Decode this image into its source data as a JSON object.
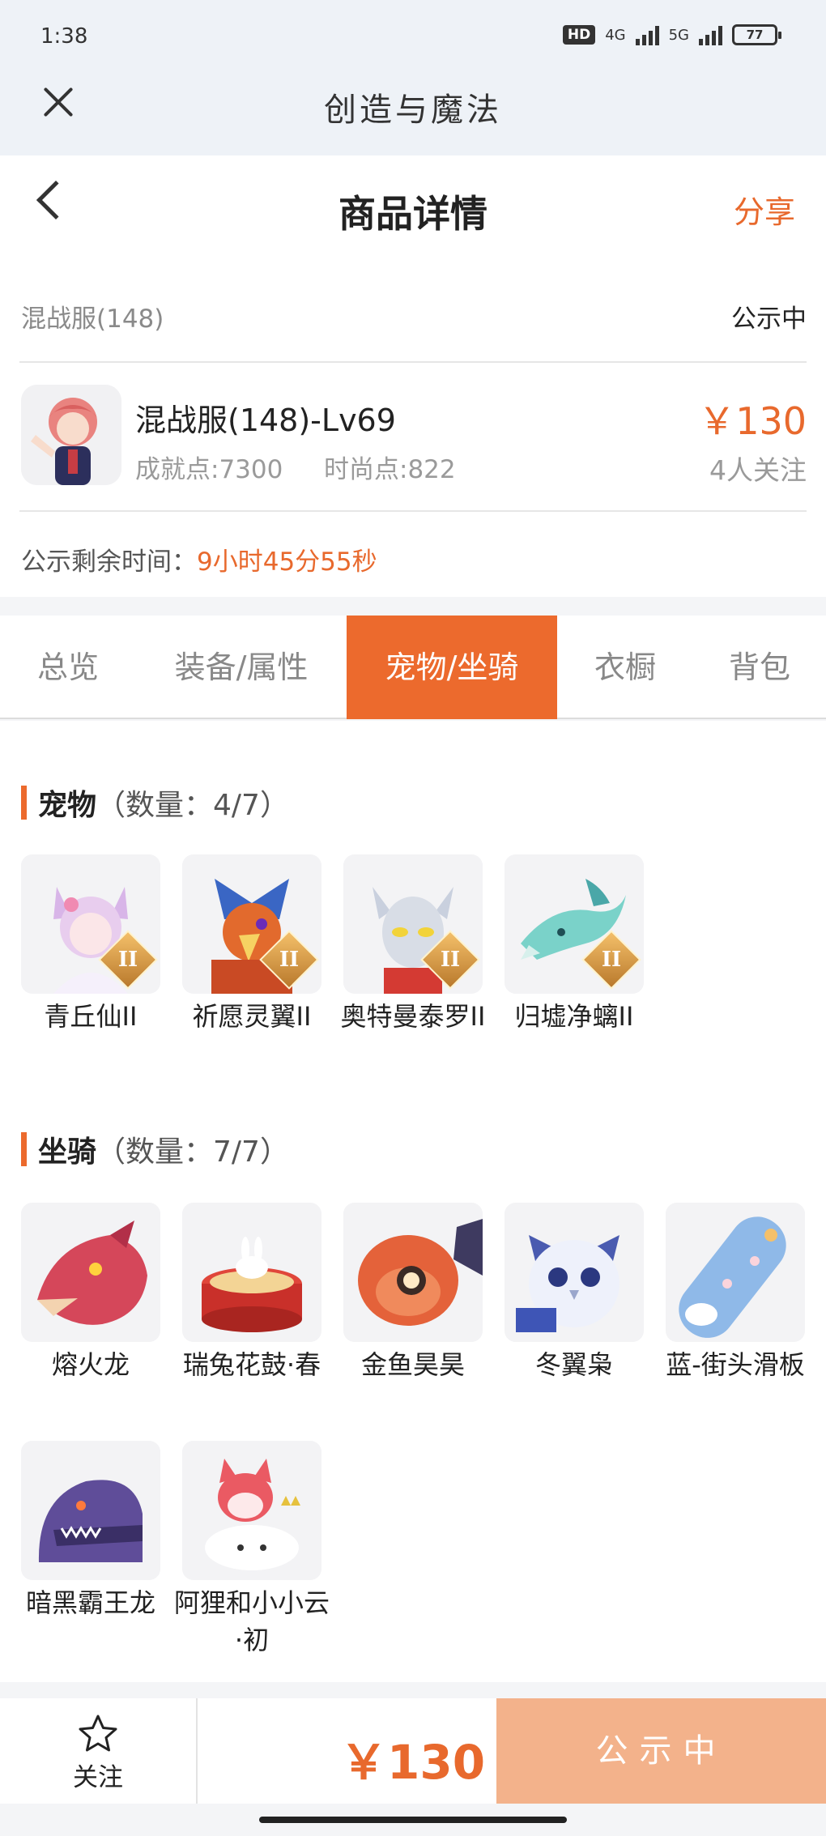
{
  "status_bar": {
    "time": "1:38",
    "network": "4G",
    "network2": "5G",
    "hd": "HD",
    "battery": "77"
  },
  "app_bar": {
    "title": "创造与魔法"
  },
  "header": {
    "title": "商品详情",
    "share_label": "分享"
  },
  "listing": {
    "server": "混战服(148)",
    "status": "公示中",
    "name": "混战服(148)-Lv69",
    "achievement": "成就点:7300",
    "fashion": "时尚点:822",
    "price": "￥130",
    "followers": "4人关注",
    "remain_label": "公示剩余时间：",
    "remain_time": "9小时45分55秒"
  },
  "tabs": [
    {
      "label": "总览",
      "active": false
    },
    {
      "label": "装备/属性",
      "active": false
    },
    {
      "label": "宠物/坐骑",
      "active": true
    },
    {
      "label": "衣橱",
      "active": false
    },
    {
      "label": "背包",
      "active": false
    }
  ],
  "pets": {
    "title": "宠物",
    "count": "（数量：4/7）",
    "items": [
      {
        "name": "青丘仙II",
        "badge": "II",
        "icon": "fox-fairy-icon"
      },
      {
        "name": "祈愿灵翼II",
        "badge": "II",
        "icon": "eagle-icon"
      },
      {
        "name": "奥特曼泰罗II",
        "badge": "II",
        "icon": "ultraman-icon"
      },
      {
        "name": "归墟净螭II",
        "badge": "II",
        "icon": "dragon-icon"
      }
    ]
  },
  "mounts": {
    "title": "坐骑",
    "count": "（数量：7/7）",
    "items": [
      {
        "name": "熔火龙",
        "icon": "fire-dragon-icon"
      },
      {
        "name": "瑞兔花鼓·春",
        "icon": "rabbit-drum-icon"
      },
      {
        "name": "金鱼昊昊",
        "icon": "goldfish-icon"
      },
      {
        "name": "冬翼枭",
        "icon": "owl-icon"
      },
      {
        "name": "蓝-街头滑板",
        "icon": "skateboard-icon"
      },
      {
        "name": "暗黑霸王龙",
        "icon": "trex-icon"
      },
      {
        "name": "阿狸和小小云·初",
        "icon": "fox-cloud-icon"
      }
    ]
  },
  "bottom_bar": {
    "follow_label": "关注",
    "price": "￥130",
    "action_label": "公示中"
  }
}
